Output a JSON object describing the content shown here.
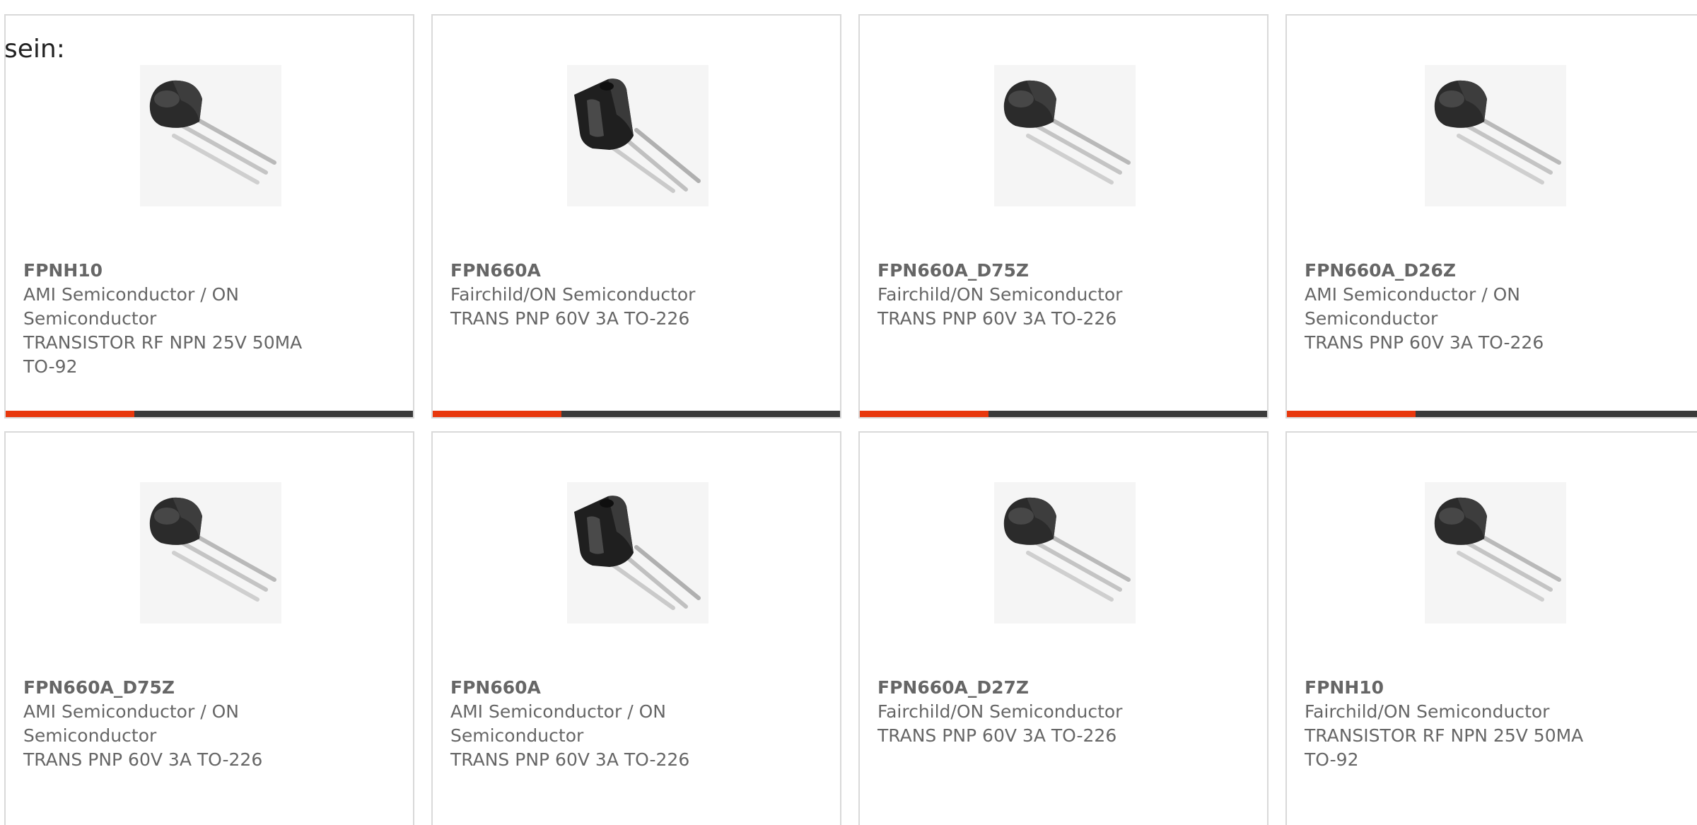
{
  "intro_text": "sein:",
  "colors": {
    "accent": "#e8380d",
    "bar_dark": "#3b3b3b",
    "text_gray": "#666666",
    "border": "#d9d9d9"
  },
  "products": [
    {
      "part": "FPNH10",
      "manufacturer": "AMI Semiconductor / ON Semiconductor",
      "description": "TRANSISTOR RF NPN 25V 50MA TO-92",
      "image_icon": "to92-transistor-icon"
    },
    {
      "part": "FPN660A",
      "manufacturer": "Fairchild/ON Semiconductor",
      "description": "TRANS PNP 60V 3A TO-226",
      "image_icon": "to226-transistor-icon"
    },
    {
      "part": "FPN660A_D75Z",
      "manufacturer": "Fairchild/ON Semiconductor",
      "description": "TRANS PNP 60V 3A TO-226",
      "image_icon": "to92-transistor-icon"
    },
    {
      "part": "FPN660A_D26Z",
      "manufacturer": "AMI Semiconductor / ON Semiconductor",
      "description": "TRANS PNP 60V 3A TO-226",
      "image_icon": "to92-transistor-icon"
    },
    {
      "part": "FPN660A_D75Z",
      "manufacturer": "AMI Semiconductor / ON Semiconductor",
      "description": "TRANS PNP 60V 3A TO-226",
      "image_icon": "to92-transistor-icon"
    },
    {
      "part": "FPN660A",
      "manufacturer": "AMI Semiconductor / ON Semiconductor",
      "description": "TRANS PNP 60V 3A TO-226",
      "image_icon": "to226-transistor-icon"
    },
    {
      "part": "FPN660A_D27Z",
      "manufacturer": "Fairchild/ON Semiconductor",
      "description": "TRANS PNP 60V 3A TO-226",
      "image_icon": "to92-transistor-icon"
    },
    {
      "part": "FPNH10",
      "manufacturer": "Fairchild/ON Semiconductor",
      "description": "TRANSISTOR RF NPN 25V 50MA TO-92",
      "image_icon": "to92-transistor-icon"
    }
  ]
}
